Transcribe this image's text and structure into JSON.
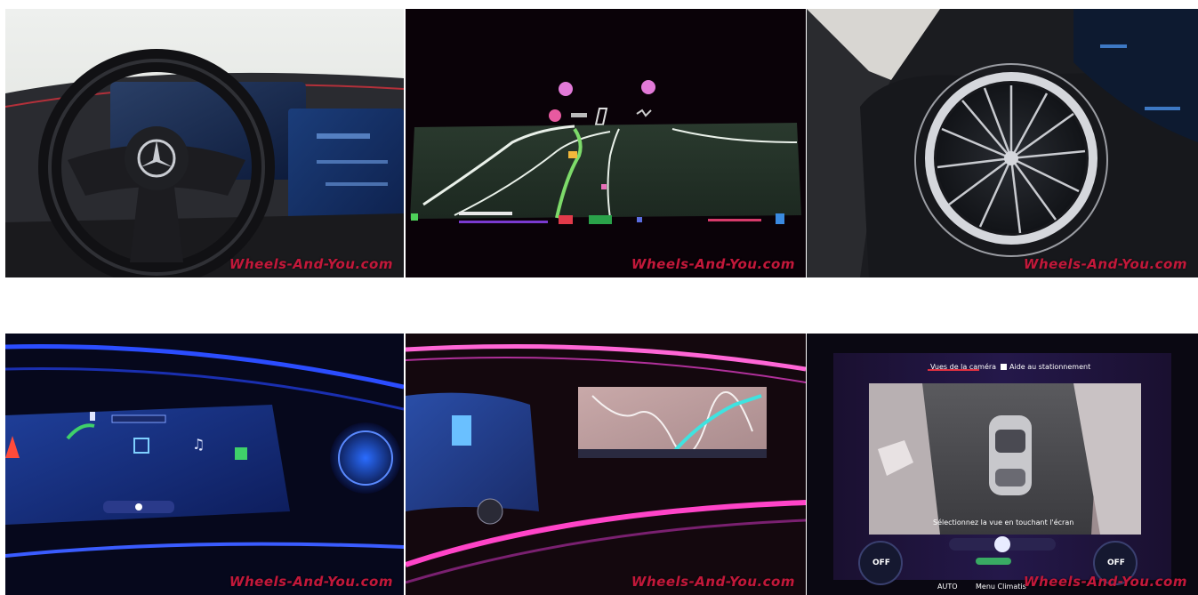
{
  "gallery": {
    "watermark": "Wheels-And-You.com",
    "photos": [
      {
        "subject": "steering-wheel-dashboard"
      },
      {
        "subject": "driver-display-navigation"
      },
      {
        "subject": "round-air-vent"
      },
      {
        "subject": "hyperscreen-ambient-blue"
      },
      {
        "subject": "navigation-ambient-pink"
      },
      {
        "subject": "camera-view-screen"
      }
    ],
    "camera_view": {
      "tab_active": "Vues de la caméra",
      "tab_other": "Aide au stationnement",
      "hint": "Sélectionnez la vue en touchant l'écran",
      "left_dial": "OFF",
      "right_dial": "OFF",
      "mode_left": "AUTO",
      "mode_center": "Menu Climatis"
    }
  }
}
